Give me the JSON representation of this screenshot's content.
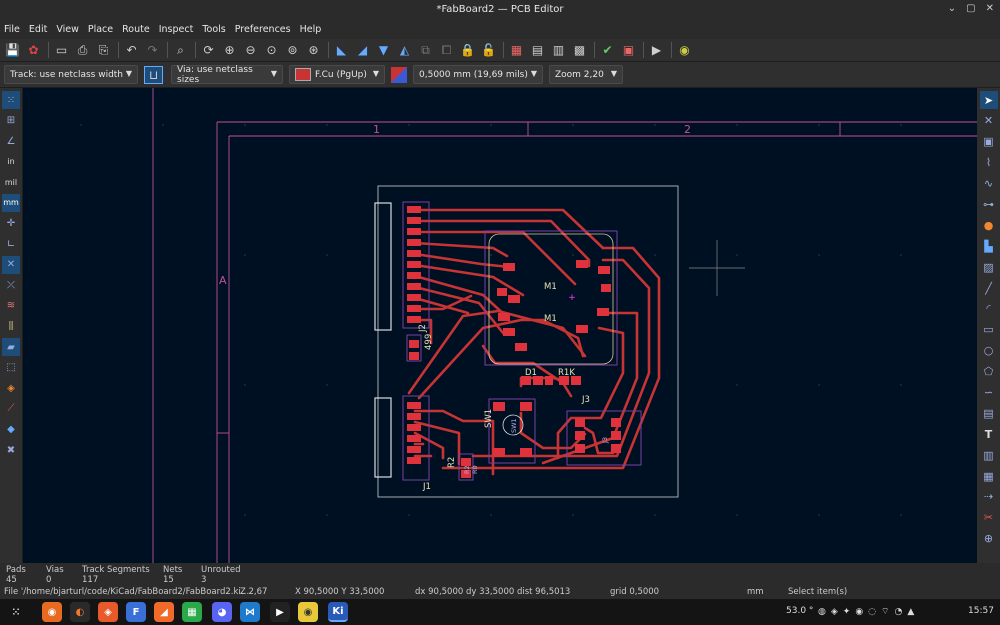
{
  "window": {
    "title": "*FabBoard2 — PCB Editor",
    "minimize": "⌄",
    "restore": "▢",
    "close": "✕"
  },
  "menu": [
    "File",
    "Edit",
    "View",
    "Place",
    "Route",
    "Inspect",
    "Tools",
    "Preferences",
    "Help"
  ],
  "toolbar2": {
    "track": "Track: use netclass width",
    "via": "Via: use netclass sizes",
    "layer": "F.Cu (PgUp)",
    "grid": "0,5000 mm (19,69 mils)",
    "zoom": "Zoom 2,20",
    "layer_color": "#c83434"
  },
  "left_toolbar": {
    "in": "in",
    "mil": "mil",
    "mm": "mm"
  },
  "canvas": {
    "background": "#001023",
    "border_color": "#c2509a",
    "zone_1": "1",
    "zone_2": "2",
    "zone_a": "A",
    "refs": {
      "m1_top": "M1",
      "m1_bottom": "M1",
      "d1": "D1",
      "r1k": "R1K",
      "j3": "J3",
      "sw1": "SW1",
      "j1": "J1",
      "r2": "R2",
      "j2": "J2",
      "r499": "499",
      "sw1_inner": "SW1",
      "j3_inner": "J3",
      "r2_inner": "R2",
      "r0": "R0"
    }
  },
  "status": {
    "pads_label": "Pads",
    "pads": "45",
    "vias_label": "Vias",
    "vias": "0",
    "tracks_label": "Track Segments",
    "tracks": "117",
    "nets_label": "Nets",
    "nets": "15",
    "unrouted_label": "Unrouted",
    "unrouted": "3"
  },
  "infoline": {
    "file": "File '/home/bjarturl/code/KiCad/FabBoard2/FabBoard2.ki…",
    "z": "Z 2,67",
    "xy": "X 90,5000  Y 33,5000",
    "dxy": "dx 90,5000  dy 33,5000  dist 96,5013",
    "grid": "grid 0,5000",
    "units": "mm",
    "hint": "Select item(s)"
  },
  "taskbar": {
    "temp": "53.0 °",
    "clock": "15:57"
  }
}
